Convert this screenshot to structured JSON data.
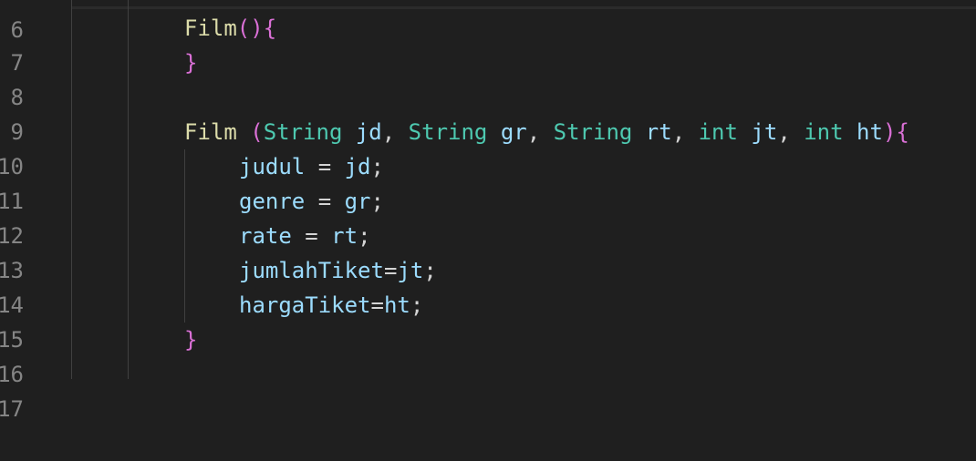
{
  "editor": {
    "line_numbers": [
      "6",
      "7",
      "8",
      "9",
      "10",
      "11",
      "12",
      "13",
      "14",
      "15",
      "16",
      "17"
    ],
    "lines": {
      "l7": {
        "name": "Film",
        "open": "(){"
      },
      "l8": {
        "close": "}"
      },
      "l10": {
        "name": "Film",
        "paren_open": "(",
        "type1": "String",
        "p1": "jd",
        "type2": "String",
        "p2": "gr",
        "type3": "String",
        "p3": "rt",
        "type4": "int",
        "p4": "jt",
        "type5": "int",
        "p5": "ht",
        "paren_close": ")",
        "brace": "{",
        "comma": ","
      },
      "l11": {
        "lhs": "judul",
        "op": " = ",
        "rhs": "jd",
        "end": ";"
      },
      "l12": {
        "lhs": "genre",
        "op": " = ",
        "rhs": "gr",
        "end": ";"
      },
      "l13": {
        "lhs": "rate",
        "op": " = ",
        "rhs": "rt",
        "end": ";"
      },
      "l14": {
        "lhs": "jumlahTiket",
        "op": "=",
        "rhs": "jt",
        "end": ";"
      },
      "l15": {
        "lhs": "hargaTiket",
        "op": "=",
        "rhs": "ht",
        "end": ";"
      },
      "l16": {
        "close": "}"
      }
    },
    "colors": {
      "background": "#1f1f1f",
      "function": "#dcdcaa",
      "bracket": "#da70d6",
      "type": "#4ec9b0",
      "variable": "#9cdcfe",
      "line_number": "#858585"
    }
  }
}
